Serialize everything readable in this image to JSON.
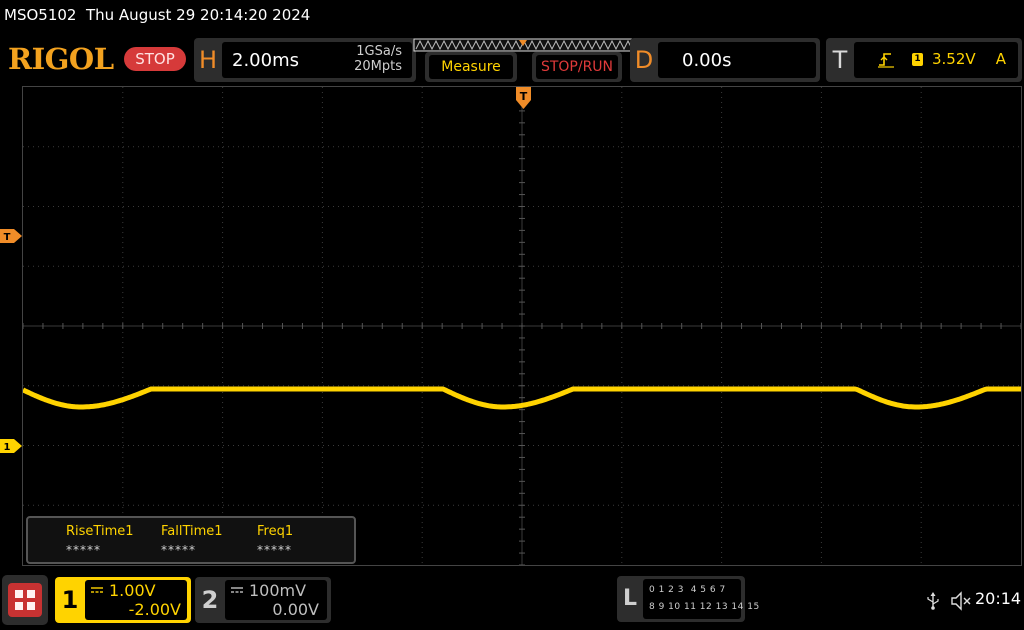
{
  "title_bar": {
    "text": "MSO5102  Thu August 29 20:14:20 2024"
  },
  "header": {
    "brand": "RIGOL",
    "status": "STOP",
    "horizontal": {
      "letter": "H",
      "timebase": "2.00ms",
      "sample_rate": "1GSa/s",
      "memory_depth": "20Mpts"
    },
    "buttons": {
      "measure": "Measure",
      "stop_run": "STOP/RUN"
    },
    "delay": {
      "letter": "D",
      "value": "0.00s"
    },
    "trigger": {
      "letter": "T",
      "channel": "1",
      "level": "3.52V",
      "mode": "A"
    }
  },
  "markers": {
    "trigger_position": "T",
    "trigger_level": "T",
    "channel1_ground": "1"
  },
  "measurements": [
    {
      "label": "RiseTime1",
      "value": "*****"
    },
    {
      "label": "FallTime1",
      "value": "*****"
    },
    {
      "label": "Freq1",
      "value": "*****"
    }
  ],
  "channels": {
    "ch1": {
      "number": "1",
      "scale": "1.00V",
      "offset": "-2.00V"
    },
    "ch2": {
      "number": "2",
      "scale": "100mV",
      "offset": "0.00V"
    }
  },
  "logic_analyzer": {
    "letter": "L",
    "row1": "0 1 2 3  4 5 6 7",
    "row2": "8 9 10 11 12 13 14 15"
  },
  "status_bar": {
    "time": "20:14"
  },
  "colors": {
    "ch1": "#ffd300",
    "accent": "#f08c28",
    "stop": "#d63a3a",
    "grid": "#3a3a3a"
  },
  "icons": [
    "menu-icon",
    "usb-icon",
    "speaker-muted-icon",
    "trigger-edge-icon",
    "dc-coupling-icon"
  ]
}
